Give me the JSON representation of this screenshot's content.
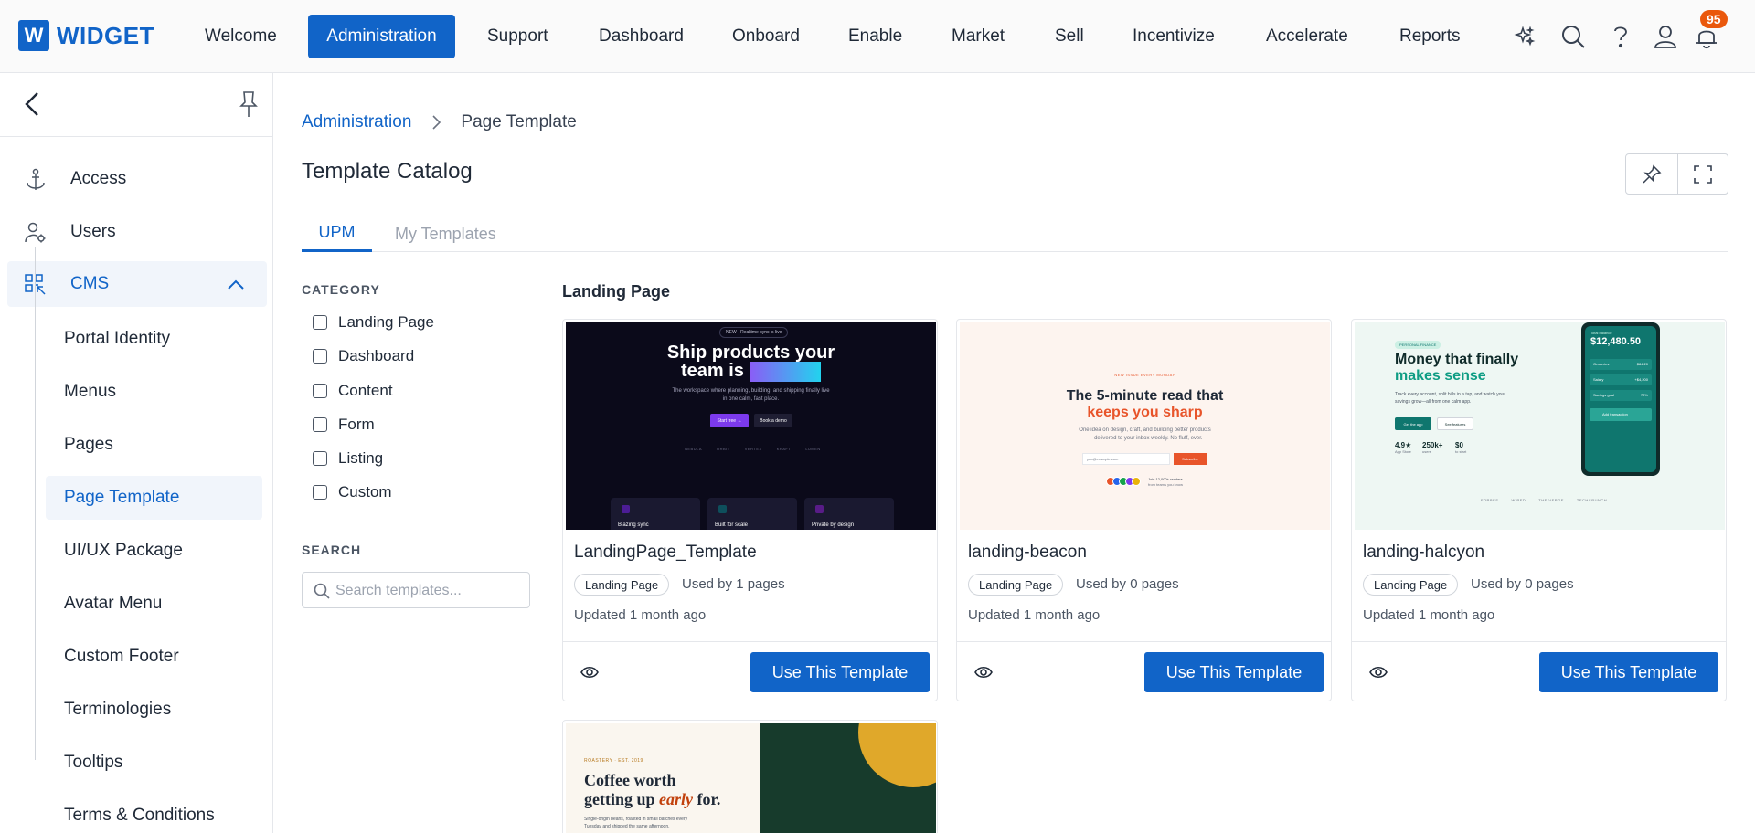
{
  "brand": {
    "logo_letter": "W",
    "name": "WIDGET",
    "accent": "#1164c8"
  },
  "nav": {
    "items": [
      "Welcome",
      "Administration",
      "Support",
      "Dashboard",
      "Onboard",
      "Enable",
      "Market",
      "Sell",
      "Incentivize",
      "Accelerate",
      "Reports"
    ],
    "active": "Administration",
    "notification_count": "95",
    "icons": [
      "sparkle-icon",
      "search-icon",
      "help-icon",
      "user-icon",
      "bell-icon"
    ]
  },
  "sidebar": {
    "items": [
      {
        "label": "Access",
        "icon": "anchor-icon"
      },
      {
        "label": "Users",
        "icon": "user-gear-icon"
      },
      {
        "label": "CMS",
        "icon": "cms-grid-icon"
      }
    ],
    "cms_children": [
      "Portal Identity",
      "Menus",
      "Pages",
      "Page Template",
      "UI/UX Package",
      "Avatar Menu",
      "Custom Footer",
      "Terminologies",
      "Tooltips",
      "Terms & Conditions"
    ],
    "active_child": "Page Template"
  },
  "breadcrumb": {
    "parent": "Administration",
    "current": "Page Template"
  },
  "page": {
    "title": "Template Catalog"
  },
  "tabs": [
    "UPM",
    "My Templates"
  ],
  "filters": {
    "category_heading": "CATEGORY",
    "categories": [
      "Landing Page",
      "Dashboard",
      "Content",
      "Form",
      "Listing",
      "Custom"
    ],
    "search_heading": "SEARCH",
    "search_placeholder": "Search templates..."
  },
  "section": {
    "title": "Landing Page"
  },
  "cards": [
    {
      "name": "LandingPage_Template",
      "tag": "Landing Page",
      "used": "Used by 1 pages",
      "updated": "Updated 1 month ago",
      "button": "Use This Template",
      "preview": {
        "pill": "NEW · Realtime sync is live",
        "headline1": "Ship products your",
        "headline2": "team is",
        "sub1": "The workspace where planning, building, and shipping finally live",
        "sub2": "in one calm, fast place.",
        "btn1": "Start free →",
        "btn2": "Book a demo",
        "logos": [
          "NEBULA",
          "ORBIT",
          "VERTEX",
          "KRAFT",
          "LUMEN"
        ],
        "features": [
          "Blazing sync",
          "Built for scale",
          "Private by design"
        ]
      }
    },
    {
      "name": "landing-beacon",
      "tag": "Landing Page",
      "used": "Used by 0 pages",
      "updated": "Updated 1 month ago",
      "button": "Use This Template",
      "preview": {
        "kicker": "NEW ISSUE EVERY MONDAY",
        "headline1": "The 5-minute read that",
        "headline2": "keeps you sharp",
        "sub1": "One idea on design, craft, and building better products",
        "sub2": "— delivered to your inbox weekly. No fluff, ever.",
        "input": "you@example.com",
        "btn": "Subscribe",
        "proof1": "Join 12,000+ readers",
        "proof2": "from teams you know"
      }
    },
    {
      "name": "landing-halcyon",
      "tag": "Landing Page",
      "used": "Used by 0 pages",
      "updated": "Updated 1 month ago",
      "button": "Use This Template",
      "preview": {
        "pill": "PERSONAL FINANCE",
        "headline1": "Money that finally",
        "headline2": "makes sense",
        "sub1": "Track every account, split bills in a tap, and watch your",
        "sub2": "savings grow—all from one calm app.",
        "btn1": "Get the app",
        "btn2": "See features",
        "stats": [
          [
            "4.9★",
            "App Store"
          ],
          [
            "250k+",
            "users"
          ],
          [
            "$0",
            "to start"
          ]
        ],
        "phone_label": "Total balance",
        "balance": "$12,480.50",
        "rows": [
          [
            "Groceries",
            "−$84.20"
          ],
          [
            "Salary",
            "+$4,200"
          ],
          [
            "Savings goal",
            "72%"
          ]
        ],
        "phone_btn": "Add transaction",
        "logos": [
          "FORBES",
          "WIRED",
          "THE VERGE",
          "TECHCRUNCH"
        ]
      }
    }
  ],
  "card4_preview": {
    "kicker": "ROASTERY · EST. 2019",
    "headline1": "Coffee worth",
    "headline2a": "getting up ",
    "headline2b": "early",
    "headline2c": " for.",
    "sub1": "Single-origin beans, roasted in small batches every",
    "sub2": "Tuesday and shipped the same afternoon."
  }
}
